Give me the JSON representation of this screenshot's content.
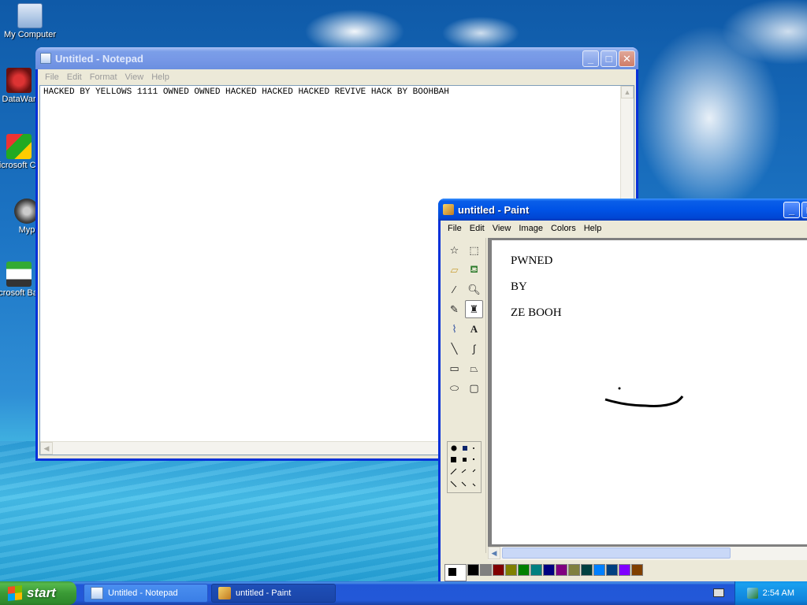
{
  "desktop": {
    "icons": [
      {
        "label": "My Computer"
      },
      {
        "label": "DataWar"
      },
      {
        "label": "Microsoft C++"
      },
      {
        "label": "Myp"
      },
      {
        "label": "Microsoft Basic"
      }
    ]
  },
  "notepad": {
    "title": "Untitled - Notepad",
    "menu": [
      "File",
      "Edit",
      "Format",
      "View",
      "Help"
    ],
    "content": "HACKED BY YELLOWS 1111 OWNED OWNED HACKED HACKED HACKED REVIVE HACK BY BOOHBAH"
  },
  "paint": {
    "title": "untitled - Paint",
    "menu": [
      "File",
      "Edit",
      "View",
      "Image",
      "Colors",
      "Help"
    ],
    "canvas_text": [
      "PWNED",
      "BY",
      "ZE BOOH"
    ],
    "selected_tool": "brush",
    "palette": [
      "#000000",
      "#808080",
      "#800000",
      "#808000",
      "#008000",
      "#008080",
      "#000080",
      "#800080",
      "#808040",
      "#004040",
      "#0080ff",
      "#004080",
      "#8000ff",
      "#804000"
    ],
    "foreground_color": "#000000",
    "background_color": "#ffffff"
  },
  "taskbar": {
    "start_label": "start",
    "tasks": [
      {
        "label": "Untitled - Notepad",
        "active": false
      },
      {
        "label": "untitled - Paint",
        "active": true
      }
    ],
    "clock": "2:54 AM"
  },
  "colors": {
    "titlebar_active": "#0053e6",
    "titlebar_inactive": "#7697e6",
    "start_green": "#3a9a35",
    "taskbar_blue": "#2358d8"
  }
}
